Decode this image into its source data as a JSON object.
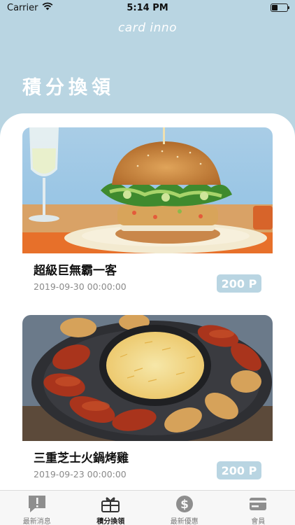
{
  "status_bar": {
    "carrier": "Carrier",
    "time": "5:14 PM"
  },
  "header": {
    "brand": "card inno",
    "title": "積分換領"
  },
  "rewards": [
    {
      "name": "超級巨無霸一客",
      "date": "2019-09-30 00:00:00",
      "points": "200 P",
      "image": "burger-photo"
    },
    {
      "name": "三重芝士火鍋烤雞",
      "date": "2019-09-23 00:00:00",
      "points": "200 P",
      "image": "cheese-chicken-hotpot-photo"
    }
  ],
  "tabbar": {
    "active": 1,
    "items": [
      {
        "label": "最新消息",
        "icon": "message-alert-icon"
      },
      {
        "label": "積分換領",
        "icon": "gift-box-icon"
      },
      {
        "label": "最新優惠",
        "icon": "dollar-coin-icon"
      },
      {
        "label": "會員",
        "icon": "member-card-icon"
      }
    ]
  },
  "colors": {
    "background": "#b9d5e2",
    "badge": "#b9d5e2",
    "text": "#111111",
    "muted": "#8a8a8a"
  }
}
